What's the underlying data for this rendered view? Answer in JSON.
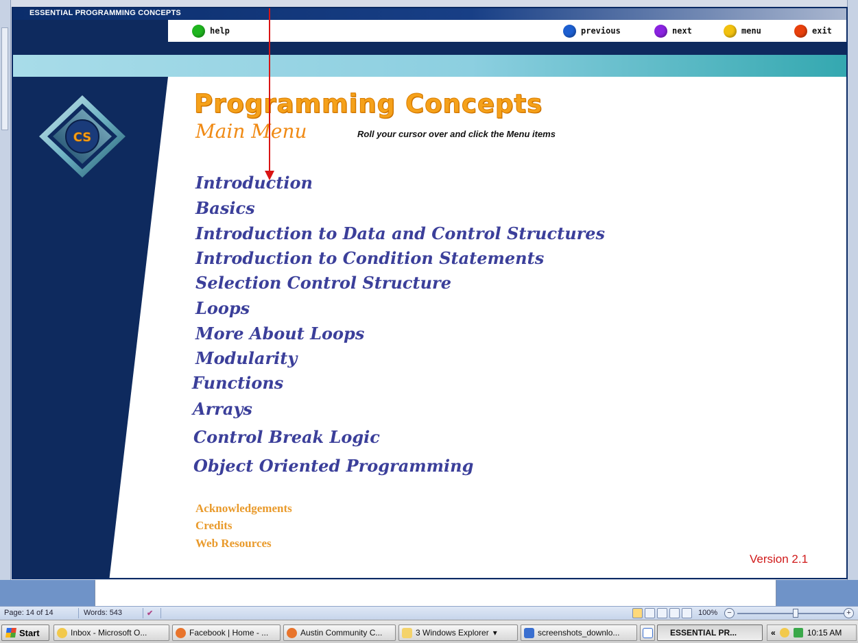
{
  "window": {
    "title": "ESSENTIAL PROGRAMMING CONCEPTS"
  },
  "nav": {
    "help": {
      "label": "help",
      "color": "#1fb51f"
    },
    "previous": {
      "label": "previous",
      "color": "#1d5fd0"
    },
    "next": {
      "label": "next",
      "color": "#8a23e0"
    },
    "menu": {
      "label": "menu",
      "color": "#f2c10f"
    },
    "exit": {
      "label": "exit",
      "color": "#e8400c"
    }
  },
  "logo": {
    "text": "CS"
  },
  "header": {
    "title": "Programming Concepts",
    "subtitle": "Main Menu",
    "hint": "Roll your cursor over and click the Menu items"
  },
  "menu": {
    "items": [
      "Introduction",
      "Basics",
      "Introduction to Data and Control Structures",
      "Introduction to Condition Statements",
      "Selection Control Structure",
      "Loops",
      "More About Loops",
      "Modularity",
      "Functions",
      "Arrays",
      "Control Break Logic",
      "Object Oriented Programming"
    ]
  },
  "links": {
    "acknowledgements": "Acknowledgements",
    "credits": "Credits",
    "web_resources": "Web Resources"
  },
  "version": "Version 2.1",
  "statusbar": {
    "page": "Page: 14 of 14",
    "words": "Words: 543",
    "zoom": "100%"
  },
  "taskbar": {
    "start": "Start",
    "tasks": [
      "Inbox - Microsoft O...",
      "Facebook | Home - ...",
      "Austin Community C...",
      "3 Windows Explorer",
      "screenshots_downlo...",
      "ESSENTIAL PR..."
    ],
    "clock": "10:15 AM"
  },
  "colors": {
    "navy": "#0e2a5e",
    "menu_text": "#3b3f9a",
    "orange": "#f5a11a",
    "link_orange": "#e99a2b",
    "version_red": "#d01818",
    "annotation_arrow": "#d91414"
  }
}
